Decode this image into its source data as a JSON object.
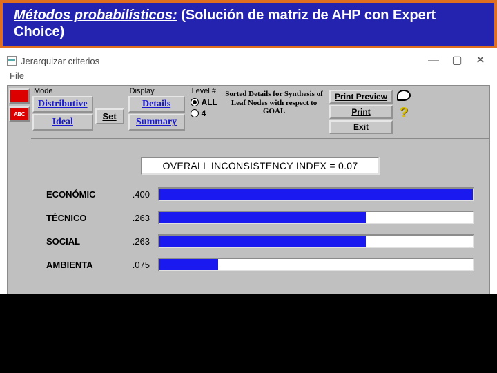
{
  "slide": {
    "title_em": "Métodos probabilísticos:",
    "title_rest": " (Solución  de matriz de AHP con Expert Choice)"
  },
  "window": {
    "title": "Jerarquizar criterios",
    "menu_file": "File",
    "controls": {
      "min": "—",
      "max": "▢",
      "close": "✕"
    }
  },
  "toolbar": {
    "mode_label": "Mode",
    "mode_distributive": "Distributive",
    "mode_ideal": "Ideal",
    "mode_set": "Set",
    "display_label": "Display",
    "display_details": "Details",
    "display_summary": "Summary",
    "level_label": "Level #",
    "level_all": "ALL",
    "level_num": "4",
    "mid_text": "Sorted Details for Synthesis of Leaf Nodes with respect to GOAL",
    "print_preview": "Print Preview",
    "print": "Print",
    "exit": "Exit"
  },
  "left_tools": {
    "abc": "ABC"
  },
  "inconsistency": {
    "label": "OVERALL INCONSISTENCY INDEX =  0.07"
  },
  "chart_data": {
    "type": "bar",
    "title": "Sorted Details for Synthesis of Leaf Nodes with respect to GOAL",
    "xlabel": "",
    "ylabel": "",
    "ylim": [
      0,
      0.4
    ],
    "categories": [
      "ECONÓMIC",
      "TÉCNICO",
      "SOCIAL",
      "AMBIENTA"
    ],
    "values": [
      0.4,
      0.263,
      0.263,
      0.075
    ],
    "value_labels": [
      ".400",
      ".263",
      ".263",
      ".075"
    ]
  }
}
